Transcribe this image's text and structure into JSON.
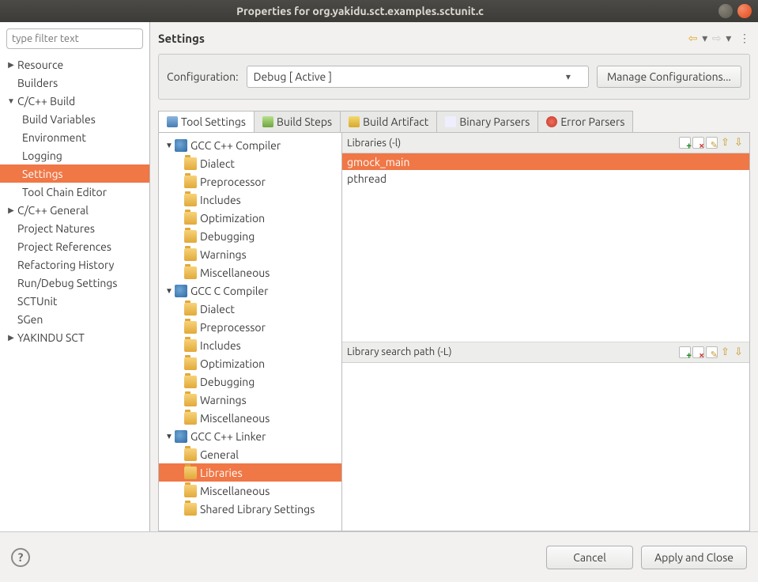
{
  "window": {
    "title": "Properties for org.yakidu.sct.examples.sctunit.c"
  },
  "sidebar": {
    "filter_placeholder": "type filter text",
    "items": [
      {
        "label": "Resource",
        "depth": 0,
        "expandable": true,
        "expanded": false
      },
      {
        "label": "Builders",
        "depth": 0
      },
      {
        "label": "C/C++ Build",
        "depth": 0,
        "expandable": true,
        "expanded": true
      },
      {
        "label": "Build Variables",
        "depth": 1
      },
      {
        "label": "Environment",
        "depth": 1
      },
      {
        "label": "Logging",
        "depth": 1
      },
      {
        "label": "Settings",
        "depth": 1,
        "selected": true
      },
      {
        "label": "Tool Chain Editor",
        "depth": 1
      },
      {
        "label": "C/C++ General",
        "depth": 0,
        "expandable": true,
        "expanded": false
      },
      {
        "label": "Project Natures",
        "depth": 0
      },
      {
        "label": "Project References",
        "depth": 0
      },
      {
        "label": "Refactoring History",
        "depth": 0
      },
      {
        "label": "Run/Debug Settings",
        "depth": 0
      },
      {
        "label": "SCTUnit",
        "depth": 0
      },
      {
        "label": "SGen",
        "depth": 0
      },
      {
        "label": "YAKINDU SCT",
        "depth": 0,
        "expandable": true,
        "expanded": false
      }
    ]
  },
  "header": {
    "title": "Settings"
  },
  "config": {
    "label": "Configuration:",
    "value": "Debug  [ Active ]",
    "manage_label": "Manage Configurations..."
  },
  "tabs": [
    {
      "label": "Tool Settings",
      "active": true,
      "icon": "ic-tool"
    },
    {
      "label": "Build Steps",
      "icon": "ic-steps"
    },
    {
      "label": "Build Artifact",
      "icon": "ic-art"
    },
    {
      "label": "Binary Parsers",
      "icon": "ic-bin"
    },
    {
      "label": "Error Parsers",
      "icon": "ic-err"
    }
  ],
  "tool_tree": [
    {
      "label": "GCC C++ Compiler",
      "depth": 0,
      "group": true
    },
    {
      "label": "Dialect",
      "depth": 1
    },
    {
      "label": "Preprocessor",
      "depth": 1
    },
    {
      "label": "Includes",
      "depth": 1
    },
    {
      "label": "Optimization",
      "depth": 1
    },
    {
      "label": "Debugging",
      "depth": 1
    },
    {
      "label": "Warnings",
      "depth": 1
    },
    {
      "label": "Miscellaneous",
      "depth": 1
    },
    {
      "label": "GCC C Compiler",
      "depth": 0,
      "group": true
    },
    {
      "label": "Dialect",
      "depth": 1
    },
    {
      "label": "Preprocessor",
      "depth": 1
    },
    {
      "label": "Includes",
      "depth": 1
    },
    {
      "label": "Optimization",
      "depth": 1
    },
    {
      "label": "Debugging",
      "depth": 1
    },
    {
      "label": "Warnings",
      "depth": 1
    },
    {
      "label": "Miscellaneous",
      "depth": 1
    },
    {
      "label": "GCC C++ Linker",
      "depth": 0,
      "group": true
    },
    {
      "label": "General",
      "depth": 1
    },
    {
      "label": "Libraries",
      "depth": 1,
      "selected": true
    },
    {
      "label": "Miscellaneous",
      "depth": 1
    },
    {
      "label": "Shared Library Settings",
      "depth": 1
    }
  ],
  "panels": {
    "libs": {
      "title": "Libraries (-l)",
      "items": [
        {
          "label": "gmock_main",
          "selected": true
        },
        {
          "label": "pthread"
        }
      ]
    },
    "search": {
      "title": "Library search path (-L)",
      "items": []
    }
  },
  "footer": {
    "cancel": "Cancel",
    "apply": "Apply and Close"
  }
}
